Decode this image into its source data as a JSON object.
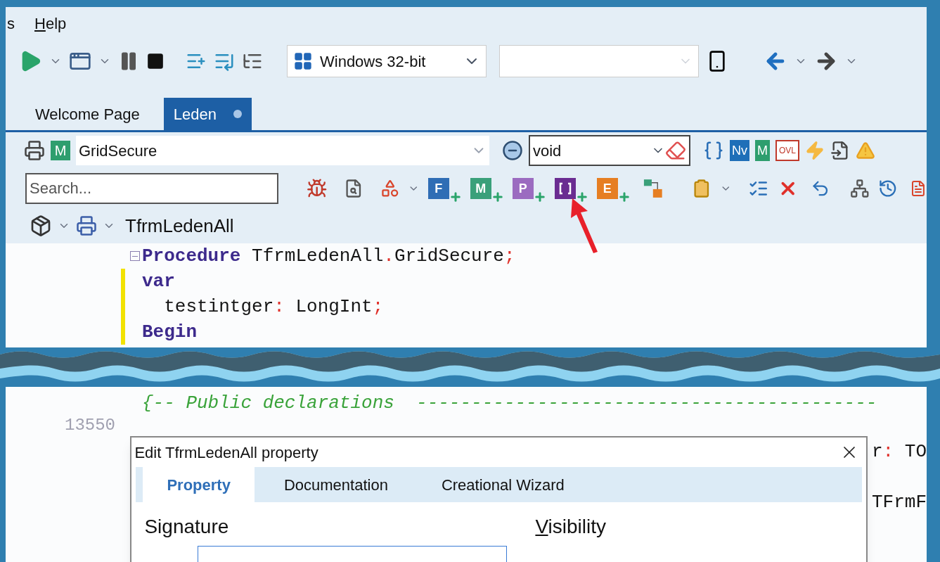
{
  "menu": [
    {
      "label": "s",
      "mnemonic": false
    },
    {
      "label": "Help",
      "mnemonic": true
    }
  ],
  "main_toolbar": {
    "platform": "Windows 32-bit"
  },
  "tabs": [
    {
      "label": "Welcome Page",
      "selected": false,
      "modified": false
    },
    {
      "label": "Leden",
      "selected": true,
      "modified": true
    }
  ],
  "member_bar": {
    "badge": {
      "label": "M",
      "color": "#2e9e6e"
    },
    "method": "GridSecure",
    "type": "void",
    "badges": [
      {
        "label": "Nv",
        "color": "#1f6fb8"
      },
      {
        "label": "M",
        "color": "#2e9e6e"
      },
      {
        "label": "OVL",
        "color": "#c0392b"
      }
    ]
  },
  "search": {
    "placeholder": "Search..."
  },
  "add_buttons": [
    {
      "kind": "letter",
      "label": "F",
      "color": "#2f6db5"
    },
    {
      "kind": "letter",
      "label": "M",
      "color": "#3aa07a"
    },
    {
      "kind": "letter",
      "label": "P",
      "color": "#9b6bc0"
    },
    {
      "kind": "bracket",
      "color": "#6a2c91"
    },
    {
      "kind": "letter",
      "label": "E",
      "color": "#e67e22"
    }
  ],
  "breadcrumb": "TfrmLedenAll",
  "code_top": [
    {
      "fold": true,
      "changed": false,
      "tokens": [
        {
          "kind": "keyword",
          "text": "Procedure"
        },
        {
          "kind": "ident",
          "text": " TfrmLedenAll"
        },
        {
          "kind": "punct",
          "text": "."
        },
        {
          "kind": "ident",
          "text": "GridSecure"
        },
        {
          "kind": "punct",
          "text": ";"
        }
      ]
    },
    {
      "fold": false,
      "changed": true,
      "tokens": [
        {
          "kind": "keyword",
          "text": "var"
        }
      ]
    },
    {
      "fold": false,
      "changed": true,
      "tokens": [
        {
          "kind": "ident",
          "text": "  testintger"
        },
        {
          "kind": "punct",
          "text": ":"
        },
        {
          "kind": "ident",
          "text": " LongInt"
        },
        {
          "kind": "punct",
          "text": ";"
        }
      ]
    },
    {
      "fold": false,
      "changed": true,
      "tokens": [
        {
          "kind": "keyword",
          "text": "Begin"
        }
      ]
    }
  ],
  "code_bottom": [
    {
      "tokens": [
        {
          "kind": "comment",
          "text": "{-- Public declarations  ------------------------------------------"
        }
      ]
    }
  ],
  "line_number": "13550",
  "code_behind_dialog": [
    {
      "tokens": [
        {
          "kind": "ident",
          "text": "r"
        },
        {
          "kind": "punct",
          "text": ":"
        },
        {
          "kind": "ident",
          "text": " TO"
        }
      ]
    },
    {
      "tokens": [
        {
          "kind": "ident",
          "text": "TFrmF"
        }
      ]
    }
  ],
  "dialog": {
    "title": "Edit TfrmLedenAll property",
    "tabs": [
      {
        "label": "Property",
        "selected": true
      },
      {
        "label": "Documentation",
        "selected": false
      },
      {
        "label": "Creational Wizard",
        "selected": false
      }
    ],
    "signature": {
      "label": "Signature",
      "mnemonic": false
    },
    "visibility": {
      "label": "Visibility",
      "mnemonic": true
    }
  }
}
